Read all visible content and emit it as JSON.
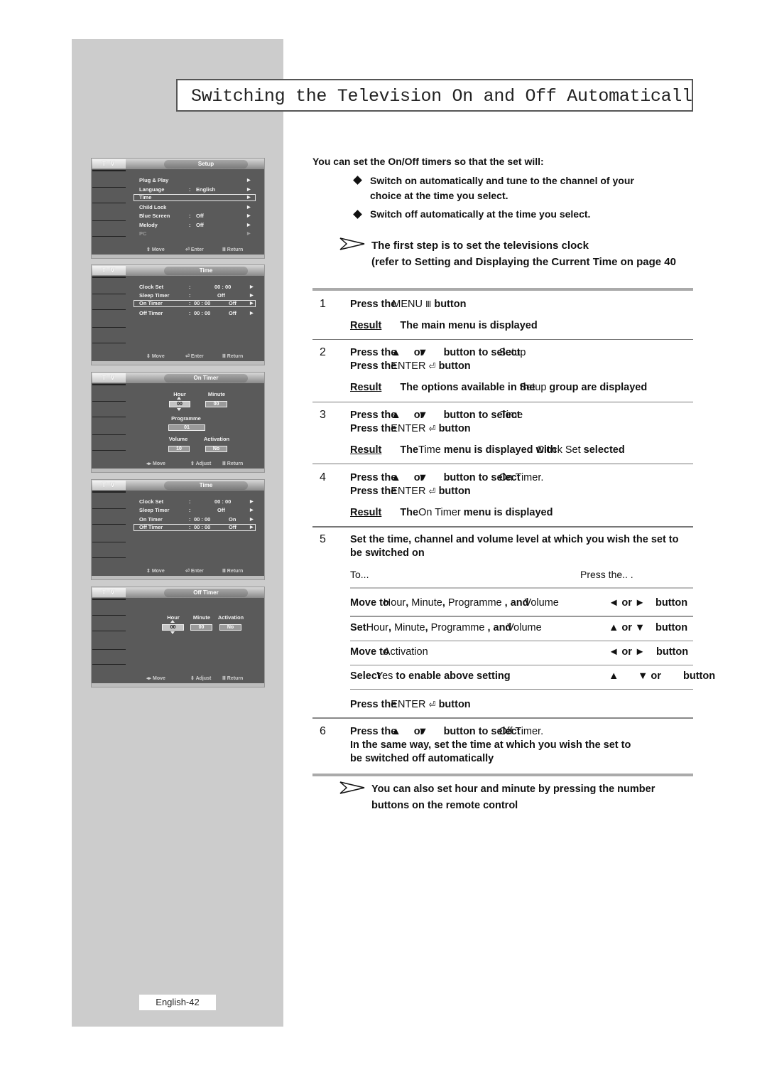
{
  "page": {
    "title": "Switching the Television On and Off Automatically",
    "page_number": "English-42"
  },
  "osd_common": {
    "tv_tab": "T V",
    "footer_move": "Move",
    "footer_enter": "Enter",
    "footer_return": "Return",
    "footer_adjust": "Adjust"
  },
  "screens": {
    "setup": {
      "title": "Setup",
      "items": [
        {
          "label": "Plug & Play",
          "value": ""
        },
        {
          "label": "Language",
          "value": "English"
        },
        {
          "label": "Time",
          "value": ""
        },
        {
          "label": "Child Lock",
          "value": ""
        },
        {
          "label": "Blue Screen",
          "value": "Off"
        },
        {
          "label": "Melody",
          "value": "Off"
        },
        {
          "label": "PC",
          "value": ""
        }
      ]
    },
    "time1": {
      "title": "Time",
      "items": [
        {
          "label": "Clock Set",
          "time": "00 : 00",
          "state": ""
        },
        {
          "label": "Sleep Timer",
          "time": "",
          "state": "Off"
        },
        {
          "label": "On Timer",
          "time": "00 : 00",
          "state": "Off"
        },
        {
          "label": "Off Timer",
          "time": "00 : 00",
          "state": "Off"
        }
      ]
    },
    "on_timer": {
      "title": "On Timer",
      "hour_label": "Hour",
      "hour": "00",
      "minute_label": "Minute",
      "minute": "00",
      "programme_label": "Programme",
      "programme": "01",
      "volume_label": "Volume",
      "volume": "10",
      "activation_label": "Activation",
      "activation": "No"
    },
    "time2": {
      "title": "Time",
      "items": [
        {
          "label": "Clock Set",
          "time": "00 : 00",
          "state": ""
        },
        {
          "label": "Sleep Timer",
          "time": "",
          "state": "Off"
        },
        {
          "label": "On Timer",
          "time": "00 : 00",
          "state": "On"
        },
        {
          "label": "Off Timer",
          "time": "00 : 00",
          "state": "Off"
        }
      ]
    },
    "off_timer": {
      "title": "Off Timer",
      "hour_label": "Hour",
      "hour": "00",
      "minute_label": "Minute",
      "minute": "00",
      "activation_label": "Activation",
      "activation": "No"
    }
  },
  "content": {
    "intro": "You can set the On/Off timers so that the set will:",
    "bullets": [
      "Switch on automatically and tune to the channel of your",
      "choice at the time you select.",
      "Switch off automatically at the time you select."
    ],
    "note1_line1": "The first step is to set the televisions clock",
    "note1_line2": "(refer to Setting and Displaying the Current Time on page 40",
    "steps": {
      "s1": {
        "num": "1",
        "press_the": "Press the",
        "key": "MENU",
        "button": "button",
        "result": "Result",
        "result_text": "The main menu is displayed"
      },
      "s2": {
        "num": "2",
        "press_the": "Press the",
        "or": "or",
        "button_to_select": "button to select",
        "target": "Setup",
        "press_the2": "Press the",
        "key": "ENTER",
        "button": "button",
        "result": "Result",
        "result_a": "The options available in the",
        "result_target": "Setup",
        "result_b": "group are displayed"
      },
      "s3": {
        "num": "3",
        "press_the": "Press the",
        "or": "or",
        "button_to_select": "button to select",
        "target": "Time",
        "press_the2": "Press the",
        "key": "ENTER",
        "button": "button",
        "result": "Result",
        "the": "The",
        "menu_name": "Time",
        "result_a": "menu is displayed with",
        "result_item": "Clock Set",
        "result_b": "selected"
      },
      "s4": {
        "num": "4",
        "press_the": "Press the",
        "or": "or",
        "button_to_select": "button to select",
        "target": "On Timer.",
        "press_the2": "Press the",
        "key": "ENTER",
        "button": "button",
        "result": "Result",
        "the": "The",
        "menu_name": "On Timer",
        "result_a": "menu is displayed"
      },
      "s5": {
        "num": "5",
        "line1": "Set the time, channel and volume level at which you wish the set to",
        "line2": "be switched on",
        "col_to": "To...",
        "col_press": "Press the.. .",
        "rows": [
          {
            "a": "Move to",
            "b": "Hour",
            "c": "Minute",
            "d": "Programme",
            "e": "and",
            "f": "Volume",
            "keys": "◄ or ►",
            "btn": "button"
          },
          {
            "a": "Set",
            "b": "Hour",
            "c": "Minute",
            "d": "Programme",
            "e": "and",
            "f": "Volume",
            "keys": "▲ or ▼",
            "btn": "button"
          },
          {
            "a": "Move to",
            "b": "Activation",
            "keys": "◄ or ►",
            "btn": "button"
          },
          {
            "a": "Select",
            "b": "Yes",
            "c": "to enable above setting",
            "k1": "▲",
            "k2": "▼ or",
            "btn": "button"
          }
        ],
        "final_press": "Press the",
        "final_key": "ENTER",
        "final_button": "button"
      },
      "s6": {
        "num": "6",
        "press_the": "Press the",
        "or": "or",
        "button_to_select": "button to select",
        "target": "Off Timer.",
        "line2": "In the same way, set the time at which you wish the set to",
        "line3": "be switched off automatically"
      }
    },
    "note2_line1": "You can also set hour and minute by pressing the number",
    "note2_line2": "buttons on the remote control"
  }
}
